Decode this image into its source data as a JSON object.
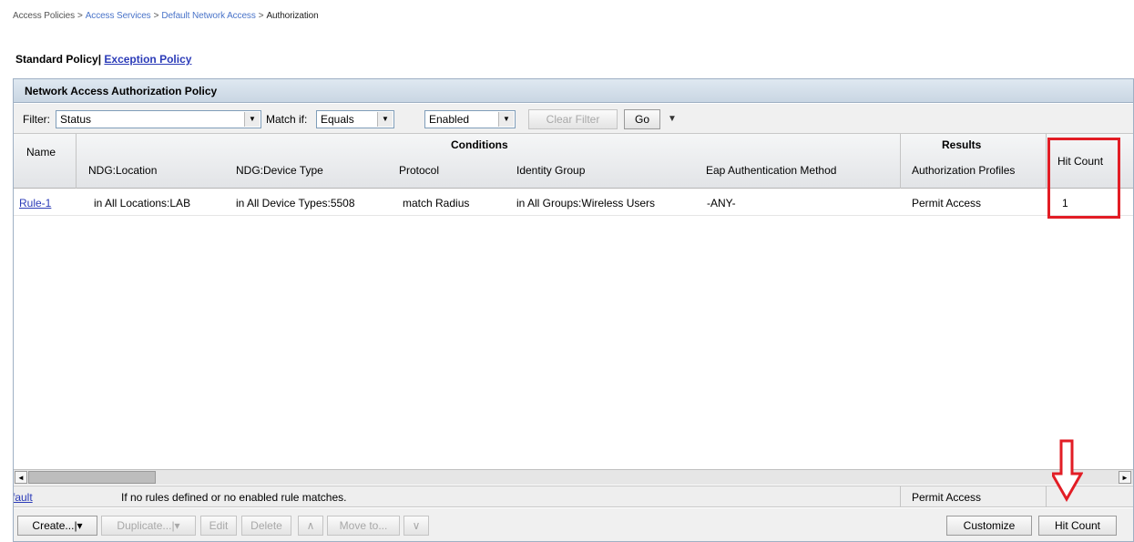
{
  "breadcrumb": {
    "item1": "Access Policies",
    "item2": "Access Services",
    "item3": "Default Network Access",
    "current": "Authorization",
    "sep": ">"
  },
  "policy_tabs": {
    "standard": "Standard Policy",
    "divider": "|",
    "exception": "Exception Policy"
  },
  "panel": {
    "title": "Network Access Authorization Policy"
  },
  "filter": {
    "filter_label": "Filter:",
    "filter_value": "Status",
    "match_label": "Match if:",
    "match_value": "Equals",
    "value": "Enabled",
    "clear_button": "Clear Filter",
    "go_button": "Go",
    "arrow": "▼",
    "caret": "▼"
  },
  "table": {
    "headers": {
      "name": "Name",
      "conditions": "Conditions",
      "results": "Results",
      "ndg_location": "NDG:Location",
      "ndg_device_type": "NDG:Device Type",
      "protocol": "Protocol",
      "identity_group": "Identity Group",
      "eap_method": "Eap Authentication Method",
      "authorization_profiles": "Authorization Profiles",
      "hit_count": "Hit Count"
    },
    "rows": [
      {
        "name": "Rule-1",
        "ndg_location": "in All Locations:LAB",
        "ndg_device_type": "in All Device Types:5508",
        "protocol": "match Radius",
        "identity_group": "in All Groups:Wireless Users",
        "eap_method": "-ANY-",
        "authorization_profile": "Permit Access",
        "hit_count": "1"
      }
    ]
  },
  "scrollbar": {
    "left_arrow": "◄",
    "right_arrow": "►"
  },
  "default_rule": {
    "name": "fault",
    "description": "If no rules defined or no enabled rule matches.",
    "result": "Permit Access"
  },
  "actions": {
    "create": "Create...",
    "duplicate": "Duplicate...",
    "edit": "Edit",
    "delete": "Delete",
    "move_up": "∧",
    "move_to": "Move to...",
    "move_down": "∨",
    "customize": "Customize",
    "hit_count": "Hit Count",
    "split_caret": "|▾"
  },
  "colors": {
    "highlight": "#e21d25",
    "link": "#2b3bb8",
    "header_bg": "#c9d6e3"
  },
  "icons": {
    "annotation": "down-arrow-icon"
  }
}
